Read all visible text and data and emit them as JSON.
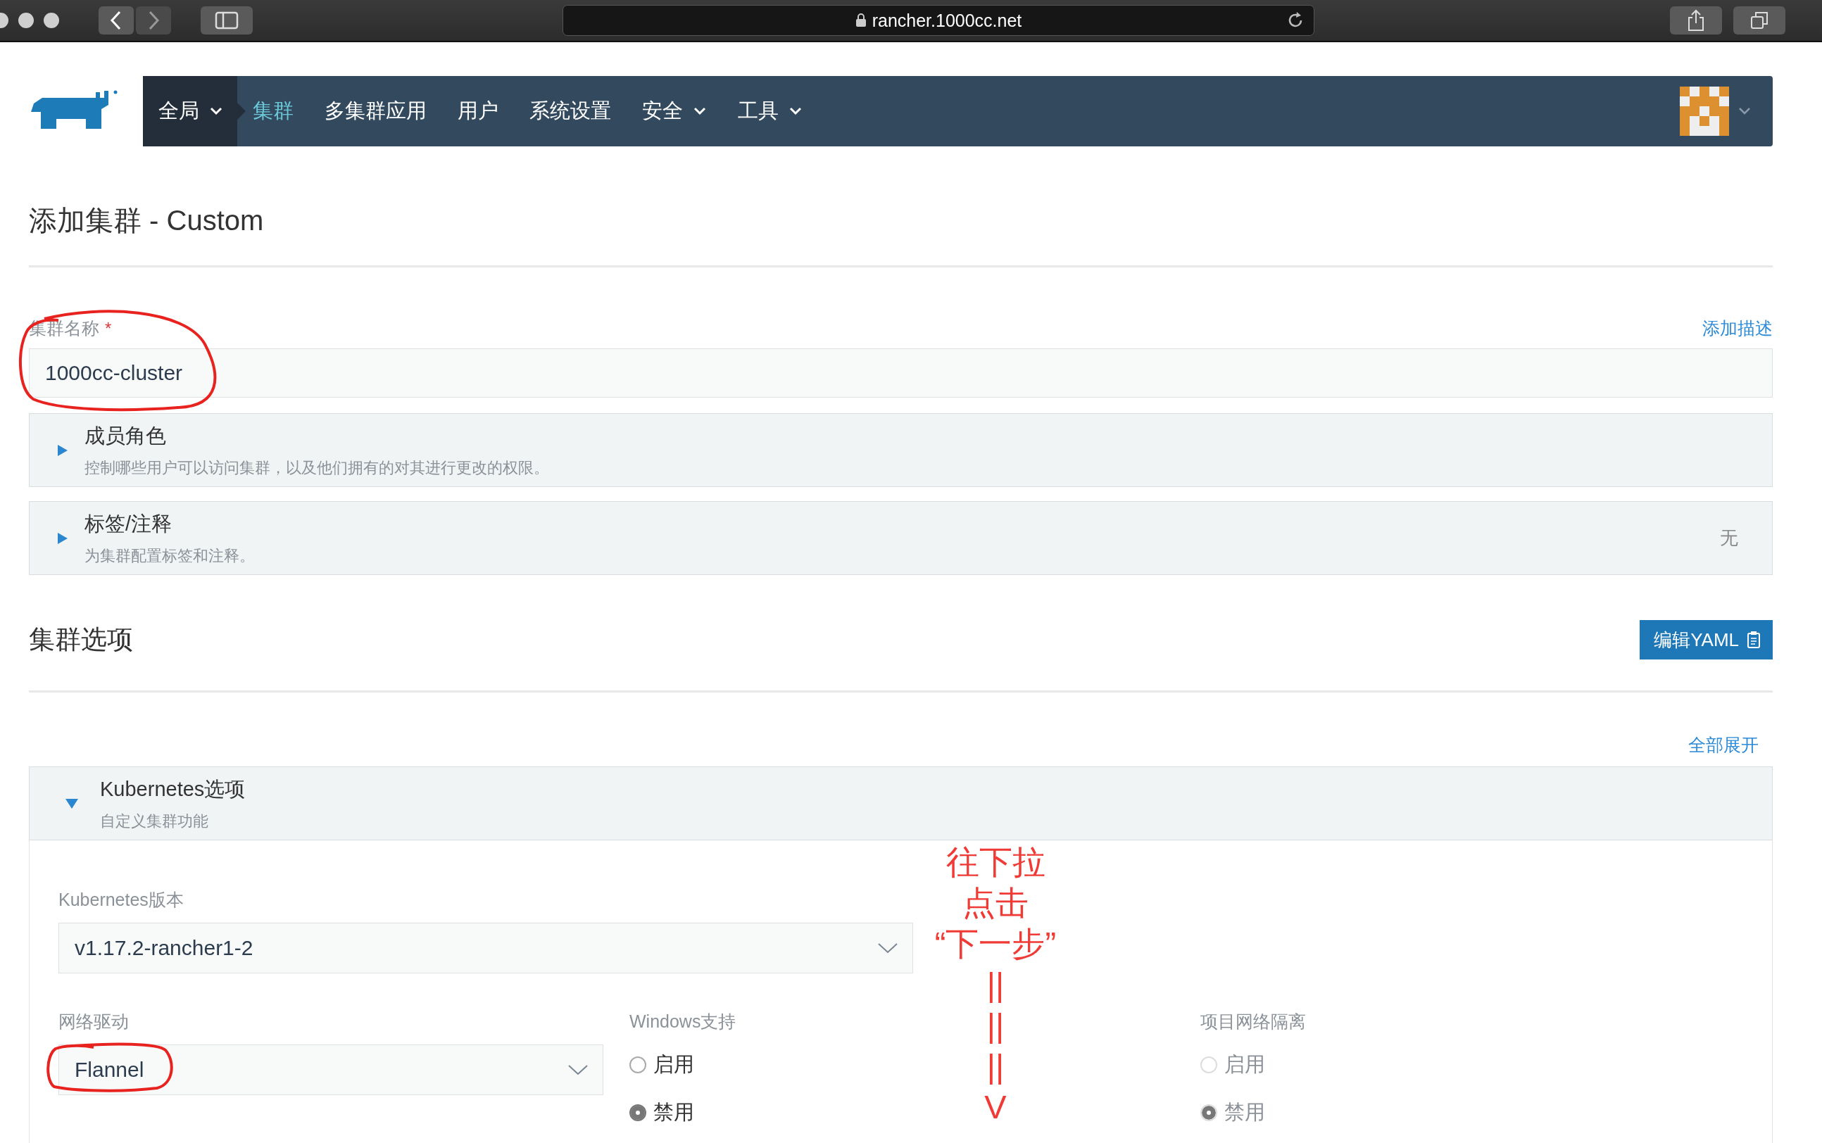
{
  "browser": {
    "url": "rancher.1000cc.net"
  },
  "nav": {
    "items": [
      {
        "label": "全局",
        "selected": false,
        "dropdown": true,
        "kind": "scope"
      },
      {
        "label": "集群",
        "selected": true,
        "dropdown": false,
        "kind": "link"
      },
      {
        "label": "多集群应用",
        "selected": false,
        "dropdown": false,
        "kind": "link"
      },
      {
        "label": "用户",
        "selected": false,
        "dropdown": false,
        "kind": "link"
      },
      {
        "label": "系统设置",
        "selected": false,
        "dropdown": false,
        "kind": "link"
      },
      {
        "label": "安全",
        "selected": false,
        "dropdown": true,
        "kind": "link"
      },
      {
        "label": "工具",
        "selected": false,
        "dropdown": true,
        "kind": "link"
      }
    ]
  },
  "page_title": "添加集群 - Custom",
  "cluster_name": {
    "label": "集群名称",
    "required_mark": "*",
    "value": "1000cc-cluster",
    "link": "添加描述",
    "circled": true
  },
  "panels": [
    {
      "title": "成员角色",
      "description": "控制哪些用户可以访问集群，以及他们拥有的对其进行更改的权限。",
      "expanded": false
    },
    {
      "title": "标签/注释",
      "description": "为集群配置标签和注释。",
      "expanded": false,
      "status": "无"
    }
  ],
  "cluster_options": {
    "title": "集群选项",
    "edit_yaml": "编辑YAML",
    "expand_all": "全部展开"
  },
  "kubernetes": {
    "title": "Kubernetes选项",
    "description": "自定义集群功能",
    "expanded": true,
    "version": {
      "label": "Kubernetes版本",
      "value": "v1.17.2-rancher1-2"
    },
    "network": {
      "label": "网络驱动",
      "value": "Flannel",
      "circled": true
    },
    "radio_groups": [
      {
        "label": "Windows支持",
        "disabled": false,
        "options": [
          {
            "label": "启用",
            "selected": false
          },
          {
            "label": "禁用",
            "selected": true
          }
        ]
      },
      {
        "label": "项目网络隔离",
        "disabled": true,
        "options": [
          {
            "label": "启用",
            "selected": false
          },
          {
            "label": "禁用",
            "selected": true
          }
        ]
      }
    ]
  },
  "annotation": {
    "lines": [
      "往下拉",
      "点击",
      "“下一步”",
      "||",
      "||",
      "||",
      "V"
    ]
  }
}
